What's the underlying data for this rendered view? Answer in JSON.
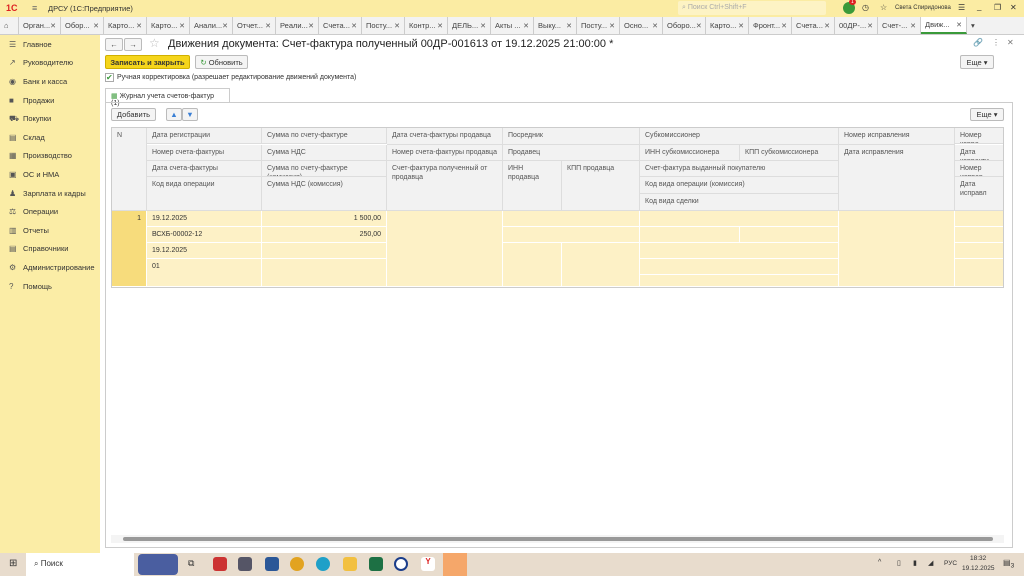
{
  "app": {
    "title": "ДРСУ  (1С:Предприятие)",
    "search_placeholder": "Поиск Ctrl+Shift+F",
    "user": "Света Спиридонова",
    "notifications": "1"
  },
  "tabs": [
    "Орган...",
    "Обор...",
    "Карто...",
    "Карто...",
    "Анали...",
    "Отчет...",
    "Реали...",
    "Счета...",
    "Посту...",
    "Контр...",
    "ДЕЛЬ...",
    "Акты ...",
    "Выку...",
    "Посту...",
    "Осно...",
    "Оборо...",
    "Карто...",
    "Фронт...",
    "Счета...",
    "00ДР-...",
    "Счет-...",
    "Движ..."
  ],
  "sidebar": [
    "Главное",
    "Руководителю",
    "Банк и касса",
    "Продажи",
    "Покупки",
    "Склад",
    "Производство",
    "ОС и НМА",
    "Зарплата и кадры",
    "Операции",
    "Отчеты",
    "Справочники",
    "Администрирование",
    "Помощь"
  ],
  "sidebar_icons": [
    "☰",
    "↗",
    "◉",
    "■",
    "⛟",
    "▤",
    "▦",
    "▣",
    "♟",
    "⚖",
    "▥",
    "▤",
    "⚙",
    "?"
  ],
  "doc": {
    "title": "Движения документа: Счет-фактура полученный 00ДР-001613 от 19.12.2025 21:00:00 *",
    "save_close": "Записать и закрыть",
    "refresh": "Обновить",
    "more": "Еще",
    "manual_label": "Ручная корректировка (разрешает редактирование движений документа)",
    "manual_checked": true,
    "subtab": "Журнал учета счетов-фактур (1)",
    "add": "Добавить"
  },
  "table": {
    "headers": {
      "n": "N",
      "c1": [
        "Дата регистрации",
        "Номер счета-фактуры",
        "Дата счета-фактуры",
        "Код вида операции"
      ],
      "c2": [
        "Сумма по счету-фактуре",
        "Сумма НДС",
        "Сумма по счету-фактуре (комиссия)",
        "Сумма НДС (комиссия)"
      ],
      "c3": [
        "Дата счета-фактуры продавца",
        "Номер счета-фактуры продавца",
        "Счет-фактура полученный от продавца"
      ],
      "c4": [
        "Посредник",
        "Продавец",
        "ИНН продавца",
        "КПП продавца"
      ],
      "c5": [
        "Субкомиссионер",
        "ИНН субкомиссионера",
        "КПП субкомиссионера",
        "Счет-фактура выданный покупателю",
        "Код вида операции (комиссия)",
        "Код вида сделки"
      ],
      "c6": [
        "Номер исправления",
        "Дата исправления"
      ],
      "c7": [
        "Номер корре",
        "Дата корректи",
        "Номер исправ",
        "Дата исправл"
      ]
    },
    "rows": [
      {
        "n": "1",
        "reg_date": "19.12.2025",
        "number": "ВСХБ-00002-12",
        "date": "19.12.2025",
        "op_code": "01",
        "sum": "1 500,00",
        "vat": "250,00"
      }
    ]
  },
  "taskbar": {
    "search": "Поиск",
    "lang": "РУС",
    "time": "18:32",
    "date": "19.12.2025",
    "notif_count": "3"
  }
}
